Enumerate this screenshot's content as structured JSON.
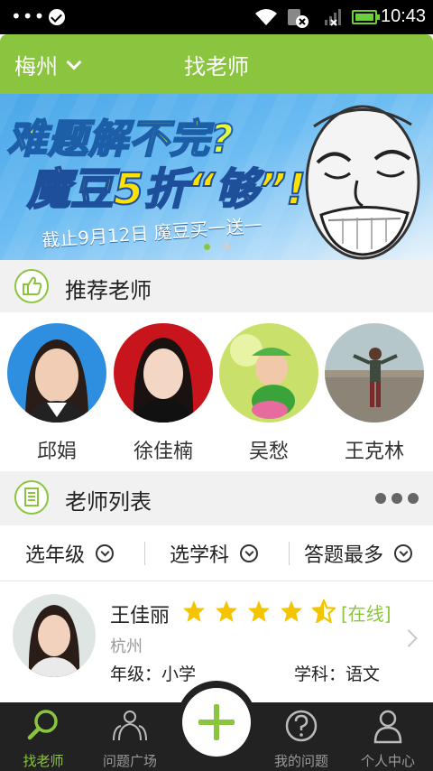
{
  "status_bar": {
    "time": "10:43"
  },
  "header": {
    "city": "梅州",
    "title": "找老师"
  },
  "banner": {
    "headline_1": "难题解不完?",
    "headline_2": "魔豆5折“够”!",
    "subline": "截止9月12日  魔豆买一送一",
    "page_index": 1,
    "page_count": 2
  },
  "recommended": {
    "title": "推荐老师",
    "teachers": [
      {
        "name": "邱娟"
      },
      {
        "name": "徐佳楠"
      },
      {
        "name": "吴愁"
      },
      {
        "name": "王克林"
      }
    ]
  },
  "teacher_list": {
    "title": "老师列表",
    "filters": [
      {
        "label": "选年级"
      },
      {
        "label": "选学科"
      },
      {
        "label": "答题最多"
      }
    ],
    "items": [
      {
        "name": "王佳丽",
        "rating": 4.5,
        "status": "[在线]",
        "city": "杭州",
        "grade": "年级：小学",
        "subject": "学科：语文"
      }
    ]
  },
  "bottom_nav": {
    "items": [
      {
        "label": "找老师",
        "icon": "search-icon",
        "active": true
      },
      {
        "label": "问题广场",
        "icon": "people-icon",
        "active": false
      },
      {
        "label": "我的问题",
        "icon": "question-icon",
        "active": false
      },
      {
        "label": "个人中心",
        "icon": "user-icon",
        "active": false
      }
    ],
    "fab_icon": "plus-icon"
  },
  "colors": {
    "accent": "#8bc53f",
    "nav_bg": "#222222",
    "section_bg": "#f1f1f1"
  }
}
